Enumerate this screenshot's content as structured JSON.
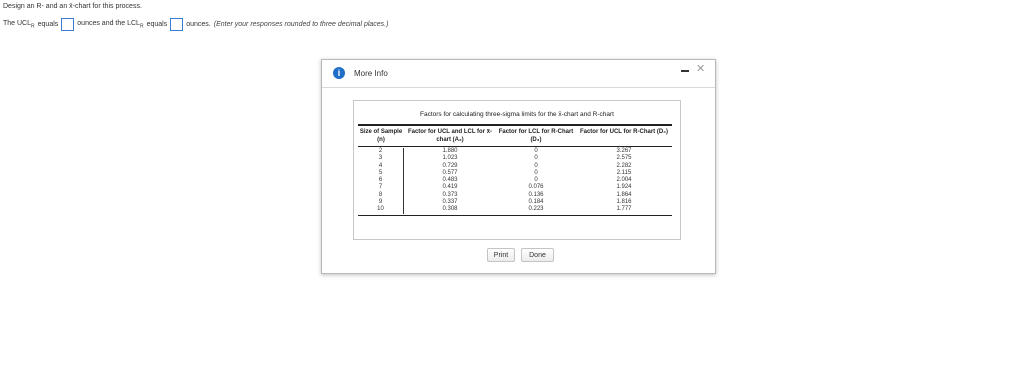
{
  "question": {
    "line1": "Design an R- and an x̄-chart for this process.",
    "ucl_prefix": "The UCL",
    "ucl_sub": "R",
    "equals1": "equals",
    "unit1": "ounces and the LCL",
    "lcl_sub": "R",
    "equals2": "equals",
    "unit2": "ounces.",
    "hint": "(Enter your responses rounded to three decimal places.)"
  },
  "dialog": {
    "info_glyph": "i",
    "title": "More Info",
    "minimize_glyph": "",
    "close_glyph": "✕",
    "print_label": "Print",
    "done_label": "Done"
  },
  "factors": {
    "title": "Factors for calculating three-sigma limits for the x̄-chart and R-chart",
    "headers": {
      "n": "Size of Sample (n)",
      "a2": "Factor for UCL and LCL for x̄-chart (A₂)",
      "d3": "Factor for LCL for R-Chart (D₃)",
      "d4": "Factor for UCL for R-Chart (D₄)"
    },
    "n": [
      "2",
      "3",
      "4",
      "5",
      "6",
      "7",
      "8",
      "9",
      "10"
    ],
    "a2": [
      "1.880",
      "1.023",
      "0.729",
      "0.577",
      "0.483",
      "0.419",
      "0.373",
      "0.337",
      "0.308"
    ],
    "d3": [
      "0",
      "0",
      "0",
      "0",
      "0",
      "0.076",
      "0.136",
      "0.184",
      "0.223"
    ],
    "d4": [
      "3.267",
      "2.575",
      "2.282",
      "2.115",
      "2.004",
      "1.924",
      "1.864",
      "1.816",
      "1.777"
    ]
  },
  "colors": {
    "info_blue": "#1f6fc6",
    "input_border": "#3a7bd5"
  }
}
